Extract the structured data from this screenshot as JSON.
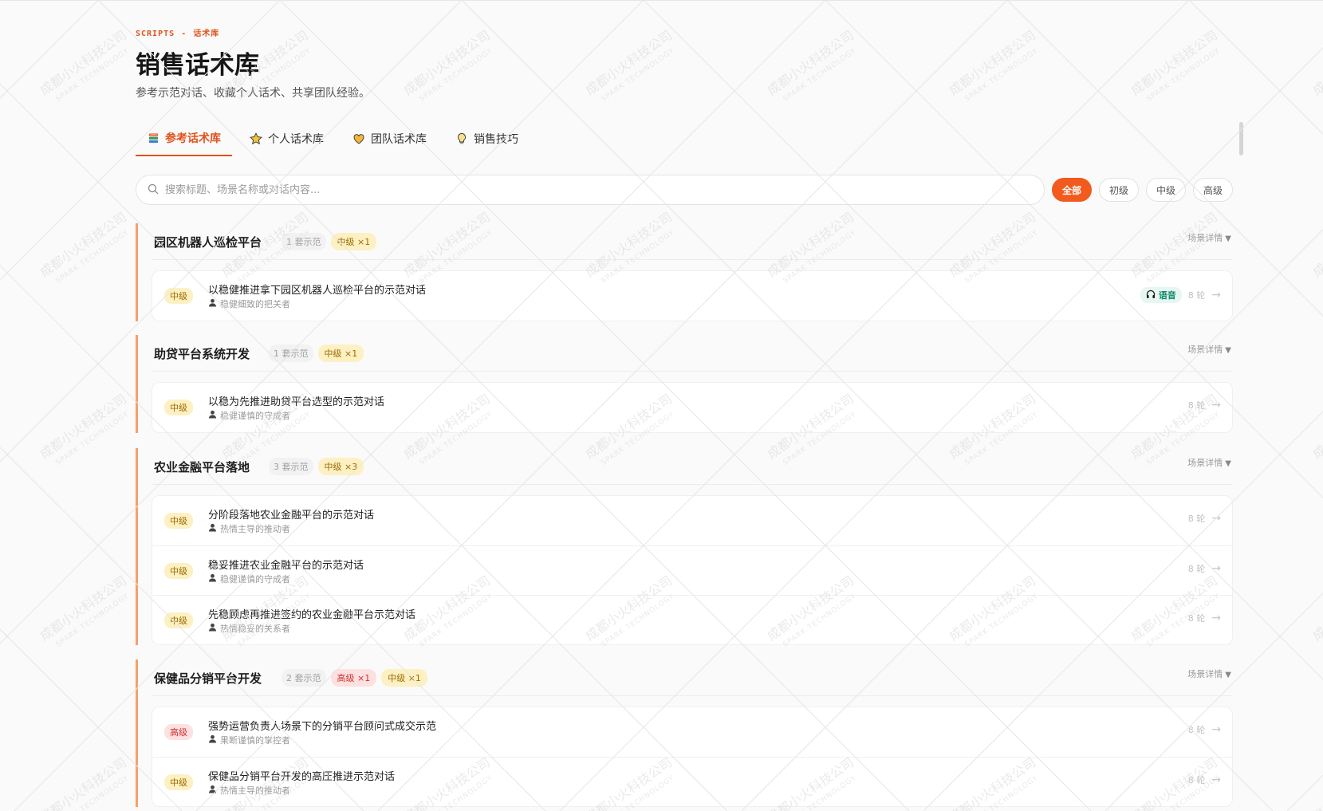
{
  "header": {
    "eyebrow_en": "SCRIPTS",
    "eyebrow_sep": "-",
    "eyebrow_cn": "话术库",
    "title": "销售话术库",
    "subtitle": "参考示范对话、收藏个人话术、共享团队经验。"
  },
  "tabs": [
    {
      "label": "参考话术库",
      "icon": "book-stack-icon",
      "active": true
    },
    {
      "label": "个人话术库",
      "icon": "star-icon",
      "active": false
    },
    {
      "label": "团队话术库",
      "icon": "heart-icon",
      "active": false
    },
    {
      "label": "销售技巧",
      "icon": "lightbulb-icon",
      "active": false
    }
  ],
  "search": {
    "placeholder": "搜索标题、场景名称或对话内容..."
  },
  "filters": [
    {
      "label": "全部",
      "active": true
    },
    {
      "label": "初级",
      "active": false
    },
    {
      "label": "中级",
      "active": false
    },
    {
      "label": "高级",
      "active": false
    }
  ],
  "detail_label": "场景详情",
  "groups": [
    {
      "title": "园区机器人巡检平台",
      "count": "1 套示范",
      "badges": [
        {
          "label": "中级 ×1",
          "level": "mid"
        }
      ],
      "items": [
        {
          "level": "中级",
          "level_type": "mid",
          "title": "以稳健推进拿下园区机器人巡检平台的示范对话",
          "persona": "稳健细致的把关者",
          "voice": "语音",
          "rounds": "8 轮"
        }
      ]
    },
    {
      "title": "助贷平台系统开发",
      "count": "1 套示范",
      "badges": [
        {
          "label": "中级 ×1",
          "level": "mid"
        }
      ],
      "items": [
        {
          "level": "中级",
          "level_type": "mid",
          "title": "以稳为先推进助贷平台选型的示范对话",
          "persona": "稳健谨慎的守成者",
          "rounds": "8 轮"
        }
      ]
    },
    {
      "title": "农业金融平台落地",
      "count": "3 套示范",
      "badges": [
        {
          "label": "中级 ×3",
          "level": "mid"
        }
      ],
      "items": [
        {
          "level": "中级",
          "level_type": "mid",
          "title": "分阶段落地农业金融平台的示范对话",
          "persona": "热情主导的推动者",
          "rounds": "8 轮"
        },
        {
          "level": "中级",
          "level_type": "mid",
          "title": "稳妥推进农业金融平台的示范对话",
          "persona": "稳健谨慎的守成者",
          "rounds": "8 轮"
        },
        {
          "level": "中级",
          "level_type": "mid",
          "title": "先稳顾虑再推进签约的农业金融平台示范对话",
          "persona": "热情稳妥的关系者",
          "rounds": "8 轮"
        }
      ]
    },
    {
      "title": "保健品分销平台开发",
      "count": "2 套示范",
      "badges": [
        {
          "label": "高级 ×1",
          "level": "high"
        },
        {
          "label": "中级 ×1",
          "level": "mid"
        }
      ],
      "items": [
        {
          "level": "高级",
          "level_type": "high",
          "title": "强势运营负责人场景下的分销平台顾问式成交示范",
          "persona": "果断谨慎的掌控者",
          "rounds": "8 轮"
        },
        {
          "level": "中级",
          "level_type": "mid",
          "title": "保健品分销平台开发的高压推进示范对话",
          "persona": "热情主导的推动者",
          "rounds": "8 轮"
        }
      ]
    }
  ],
  "watermark": {
    "cn": "成都小火科技公司",
    "en": "SPARK TECHNOLOGY"
  },
  "colors": {
    "accent": "#f25a1e",
    "group_bar": "#f6a06a",
    "voice": "#0f8a6a"
  }
}
